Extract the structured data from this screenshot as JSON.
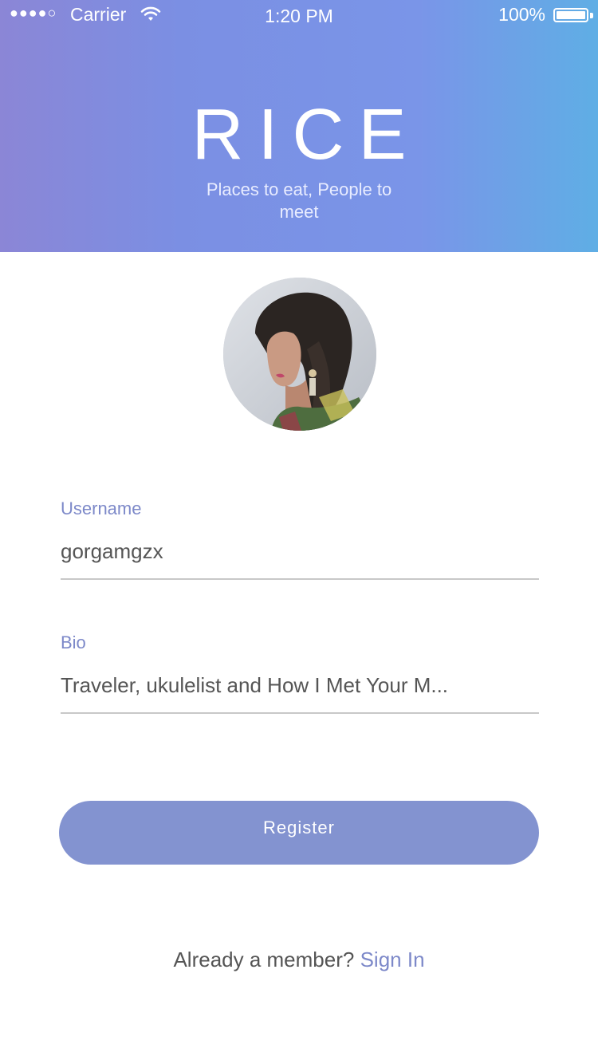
{
  "status_bar": {
    "signal": "●●●●○",
    "carrier": "Carrier",
    "time": "1:20 PM",
    "battery": "100%"
  },
  "header": {
    "title": "RICE",
    "tagline": "Places to eat, People to meet"
  },
  "profile": {
    "avatar_icon": "avatar-photo"
  },
  "form": {
    "username_label": "Username",
    "username_value": "gorgamgzx",
    "bio_label": "Bio",
    "bio_value": "Traveler, ukulelist and How I Met Your M..."
  },
  "actions": {
    "register_label": "Register",
    "already_member": "Already a member?",
    "sign_in": "Sign In"
  },
  "colors": {
    "accent": "#7d89c9",
    "button": "#8393d0",
    "header_gradient_start": "#8b86d6",
    "header_gradient_end": "#5faee5"
  }
}
